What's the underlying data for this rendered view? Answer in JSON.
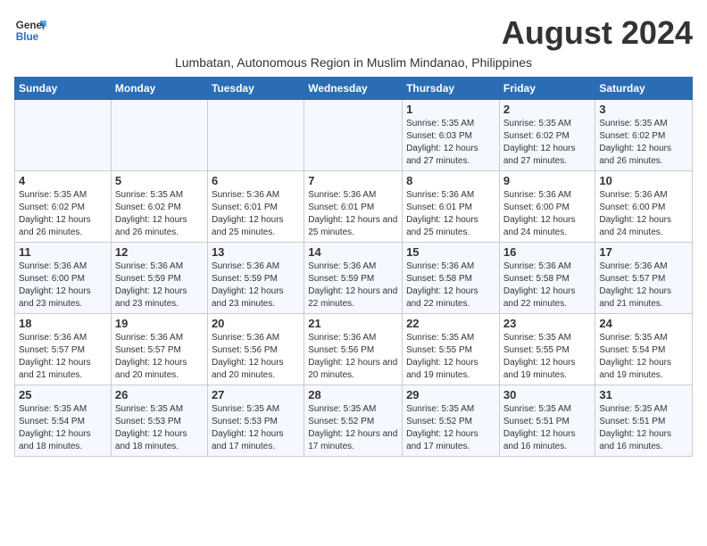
{
  "logo": {
    "line1": "General",
    "line2": "Blue"
  },
  "title": "August 2024",
  "subtitle": "Lumbatan, Autonomous Region in Muslim Mindanao, Philippines",
  "days_of_week": [
    "Sunday",
    "Monday",
    "Tuesday",
    "Wednesday",
    "Thursday",
    "Friday",
    "Saturday"
  ],
  "weeks": [
    [
      {
        "day": "",
        "info": ""
      },
      {
        "day": "",
        "info": ""
      },
      {
        "day": "",
        "info": ""
      },
      {
        "day": "",
        "info": ""
      },
      {
        "day": "1",
        "sunrise": "5:35 AM",
        "sunset": "6:03 PM",
        "daylight": "12 hours and 27 minutes."
      },
      {
        "day": "2",
        "sunrise": "5:35 AM",
        "sunset": "6:02 PM",
        "daylight": "12 hours and 27 minutes."
      },
      {
        "day": "3",
        "sunrise": "5:35 AM",
        "sunset": "6:02 PM",
        "daylight": "12 hours and 26 minutes."
      }
    ],
    [
      {
        "day": "4",
        "sunrise": "5:35 AM",
        "sunset": "6:02 PM",
        "daylight": "12 hours and 26 minutes."
      },
      {
        "day": "5",
        "sunrise": "5:35 AM",
        "sunset": "6:02 PM",
        "daylight": "12 hours and 26 minutes."
      },
      {
        "day": "6",
        "sunrise": "5:36 AM",
        "sunset": "6:01 PM",
        "daylight": "12 hours and 25 minutes."
      },
      {
        "day": "7",
        "sunrise": "5:36 AM",
        "sunset": "6:01 PM",
        "daylight": "12 hours and 25 minutes."
      },
      {
        "day": "8",
        "sunrise": "5:36 AM",
        "sunset": "6:01 PM",
        "daylight": "12 hours and 25 minutes."
      },
      {
        "day": "9",
        "sunrise": "5:36 AM",
        "sunset": "6:00 PM",
        "daylight": "12 hours and 24 minutes."
      },
      {
        "day": "10",
        "sunrise": "5:36 AM",
        "sunset": "6:00 PM",
        "daylight": "12 hours and 24 minutes."
      }
    ],
    [
      {
        "day": "11",
        "sunrise": "5:36 AM",
        "sunset": "6:00 PM",
        "daylight": "12 hours and 23 minutes."
      },
      {
        "day": "12",
        "sunrise": "5:36 AM",
        "sunset": "5:59 PM",
        "daylight": "12 hours and 23 minutes."
      },
      {
        "day": "13",
        "sunrise": "5:36 AM",
        "sunset": "5:59 PM",
        "daylight": "12 hours and 23 minutes."
      },
      {
        "day": "14",
        "sunrise": "5:36 AM",
        "sunset": "5:59 PM",
        "daylight": "12 hours and 22 minutes."
      },
      {
        "day": "15",
        "sunrise": "5:36 AM",
        "sunset": "5:58 PM",
        "daylight": "12 hours and 22 minutes."
      },
      {
        "day": "16",
        "sunrise": "5:36 AM",
        "sunset": "5:58 PM",
        "daylight": "12 hours and 22 minutes."
      },
      {
        "day": "17",
        "sunrise": "5:36 AM",
        "sunset": "5:57 PM",
        "daylight": "12 hours and 21 minutes."
      }
    ],
    [
      {
        "day": "18",
        "sunrise": "5:36 AM",
        "sunset": "5:57 PM",
        "daylight": "12 hours and 21 minutes."
      },
      {
        "day": "19",
        "sunrise": "5:36 AM",
        "sunset": "5:57 PM",
        "daylight": "12 hours and 20 minutes."
      },
      {
        "day": "20",
        "sunrise": "5:36 AM",
        "sunset": "5:56 PM",
        "daylight": "12 hours and 20 minutes."
      },
      {
        "day": "21",
        "sunrise": "5:36 AM",
        "sunset": "5:56 PM",
        "daylight": "12 hours and 20 minutes."
      },
      {
        "day": "22",
        "sunrise": "5:35 AM",
        "sunset": "5:55 PM",
        "daylight": "12 hours and 19 minutes."
      },
      {
        "day": "23",
        "sunrise": "5:35 AM",
        "sunset": "5:55 PM",
        "daylight": "12 hours and 19 minutes."
      },
      {
        "day": "24",
        "sunrise": "5:35 AM",
        "sunset": "5:54 PM",
        "daylight": "12 hours and 19 minutes."
      }
    ],
    [
      {
        "day": "25",
        "sunrise": "5:35 AM",
        "sunset": "5:54 PM",
        "daylight": "12 hours and 18 minutes."
      },
      {
        "day": "26",
        "sunrise": "5:35 AM",
        "sunset": "5:53 PM",
        "daylight": "12 hours and 18 minutes."
      },
      {
        "day": "27",
        "sunrise": "5:35 AM",
        "sunset": "5:53 PM",
        "daylight": "12 hours and 17 minutes."
      },
      {
        "day": "28",
        "sunrise": "5:35 AM",
        "sunset": "5:52 PM",
        "daylight": "12 hours and 17 minutes."
      },
      {
        "day": "29",
        "sunrise": "5:35 AM",
        "sunset": "5:52 PM",
        "daylight": "12 hours and 17 minutes."
      },
      {
        "day": "30",
        "sunrise": "5:35 AM",
        "sunset": "5:51 PM",
        "daylight": "12 hours and 16 minutes."
      },
      {
        "day": "31",
        "sunrise": "5:35 AM",
        "sunset": "5:51 PM",
        "daylight": "12 hours and 16 minutes."
      }
    ]
  ]
}
